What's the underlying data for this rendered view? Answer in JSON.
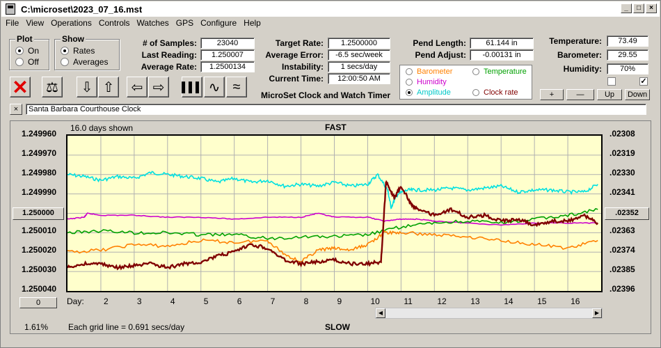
{
  "window": {
    "title": "C:\\microset\\2023_07_16.mst"
  },
  "menu": [
    "File",
    "View",
    "Operations",
    "Controls",
    "Watches",
    "GPS",
    "Configure",
    "Help"
  ],
  "plot_group": {
    "title": "Plot",
    "options": [
      {
        "label": "On",
        "selected": true
      },
      {
        "label": "Off",
        "selected": false
      }
    ]
  },
  "show_group": {
    "title": "Show",
    "options": [
      {
        "label": "Rates",
        "selected": true
      },
      {
        "label": "Averages",
        "selected": false
      }
    ]
  },
  "stats": {
    "samples_label": "# of Samples:",
    "samples": "23040",
    "last_label": "Last Reading:",
    "last": "1.250007",
    "avg_label": "Average Rate:",
    "avg": "1.2500134"
  },
  "target": {
    "rate_label": "Target Rate:",
    "rate": "1.2500000",
    "err_label": "Average Error:",
    "err": "-6.5 sec/week",
    "inst_label": "Instability:",
    "inst": "1 secs/day",
    "time_label": "Current Time:",
    "time": "12:00:50 AM"
  },
  "program_title": "MicroSet Clock and Watch Timer",
  "pend": {
    "len_label": "Pend Length:",
    "len": "61.144 in",
    "adj_label": "Pend Adjust:",
    "adj": "-0.00131 in"
  },
  "env": {
    "temp_label": "Temperature:",
    "temp": "73.49",
    "baro_label": "Barometer:",
    "baro": "29.55",
    "hum_label": "Humidity:",
    "hum": "70%"
  },
  "legend": [
    {
      "label": "Barometer",
      "color": "#ff8000",
      "selected": false
    },
    {
      "label": "Temperature",
      "color": "#00a000",
      "selected": false
    },
    {
      "label": "Humidity",
      "color": "#cc00cc",
      "selected": false
    },
    {
      "label": "Amplitude",
      "color": "#00c8c8",
      "selected": true
    },
    {
      "label": "Clock rate",
      "color": "#800000",
      "selected": false
    }
  ],
  "adjust_buttons": [
    "+",
    "—",
    "Up",
    "Down"
  ],
  "clock_name": "Santa Barbara Courthouse Clock",
  "close_x": "×",
  "chart_header": {
    "days_shown": "16.0 days shown",
    "fast": "FAST",
    "slow": "SLOW",
    "grid_note": "Each grid line = 0.691 secs/day",
    "percent": "1.61%",
    "day_label": "Day:"
  },
  "left_buttons": {
    "center": "1.250000",
    "bottom": "0"
  },
  "right_button": ".02352",
  "chart_data": {
    "type": "line",
    "y_left_ticks": [
      "1.249960",
      "1.249970",
      "1.249980",
      "1.249990",
      "1.250000",
      "1.250010",
      "1.250020",
      "1.250030",
      "1.250040"
    ],
    "y_right_ticks": [
      ".02308",
      ".02319",
      ".02330",
      ".02341",
      ".02352",
      ".02363",
      ".02374",
      ".02385",
      ".02396"
    ],
    "x_ticks": [
      "2",
      "3",
      "4",
      "5",
      "6",
      "7",
      "8",
      "9",
      "10",
      "11",
      "12",
      "13",
      "14",
      "15",
      "16"
    ],
    "xlim": [
      1,
      17
    ],
    "ylim": [
      1.24996,
      1.25004
    ],
    "series": [
      {
        "color": "#00e0e0",
        "x": [
          1,
          1.5,
          2,
          2.5,
          3,
          3.5,
          4,
          4.5,
          5,
          5.5,
          6,
          6.5,
          7,
          7.5,
          8,
          8.5,
          9,
          9.5,
          10,
          10.3,
          10.6,
          10.7,
          10.9,
          11.2,
          11.5,
          12,
          12.5,
          13,
          13.5,
          14,
          14.5,
          15,
          15.5,
          16,
          16.5,
          16.9
        ],
        "y": [
          1.24998,
          1.249981,
          1.249983,
          1.249981,
          1.249982,
          1.249979,
          1.24998,
          1.249981,
          1.249982,
          1.249984,
          1.249982,
          1.249984,
          1.249983,
          1.249986,
          1.249985,
          1.249986,
          1.249984,
          1.249986,
          1.249985,
          1.24998,
          1.249988,
          1.249997,
          1.24999,
          1.249988,
          1.249988,
          1.249988,
          1.249987,
          1.249988,
          1.249987,
          1.249986,
          1.249989,
          1.249988,
          1.249988,
          1.249989,
          1.249989,
          1.249985
        ]
      },
      {
        "color": "#cc00cc",
        "x": [
          1,
          1.5,
          1.6,
          2,
          3,
          4,
          5,
          6,
          7,
          8,
          8.5,
          9,
          10,
          10.5,
          11,
          11.5,
          12,
          13,
          14,
          15,
          16,
          16.9
        ],
        "y": [
          1.250003,
          1.250002,
          1.25,
          1.250001,
          1.250001,
          1.250002,
          1.250002,
          1.250003,
          1.250002,
          1.250002,
          1.25,
          1.250002,
          1.250002,
          1.250004,
          1.250003,
          1.250003,
          1.250004,
          1.250005,
          1.250006,
          1.250005,
          1.250005,
          1.250005
        ]
      },
      {
        "color": "#00a000",
        "x": [
          1,
          2,
          3,
          4,
          5,
          6,
          7,
          8,
          9,
          10,
          11,
          12,
          13,
          14,
          15,
          16,
          16.9
        ],
        "y": [
          1.25001,
          1.250009,
          1.25001,
          1.25001,
          1.250011,
          1.250011,
          1.250013,
          1.250012,
          1.250012,
          1.250011,
          1.250007,
          1.250005,
          1.250004,
          1.250005,
          1.250003,
          1.250001,
          1.249998
        ]
      },
      {
        "color": "#ff8000",
        "x": [
          1,
          2,
          3,
          4,
          5,
          6,
          7,
          7.5,
          8,
          8.5,
          9,
          9.5,
          10,
          10.5,
          11,
          12,
          13,
          14,
          15,
          16,
          16.9
        ],
        "y": [
          1.25002,
          1.250019,
          1.250016,
          1.250017,
          1.250014,
          1.250015,
          1.250014,
          1.250021,
          1.250025,
          1.250019,
          1.250018,
          1.250019,
          1.250016,
          1.25001,
          1.25001,
          1.250011,
          1.250012,
          1.250014,
          1.250016,
          1.250018,
          1.250014
        ]
      },
      {
        "color": "#800000",
        "x": [
          1,
          1.5,
          2,
          2.5,
          3,
          3.5,
          4,
          4.5,
          5,
          5.5,
          6,
          6.5,
          7,
          7.5,
          8,
          8.5,
          9,
          9.5,
          10,
          10.4,
          10.55,
          10.6,
          10.8,
          11,
          11.3,
          11.5,
          12,
          12.5,
          13,
          13.5,
          14,
          14.5,
          15,
          15.5,
          16,
          16.5,
          16.9
        ],
        "y": [
          1.250028,
          1.250026,
          1.250026,
          1.250028,
          1.250027,
          1.250026,
          1.250028,
          1.250026,
          1.250025,
          1.250022,
          1.25002,
          1.250016,
          1.250018,
          1.250024,
          1.250026,
          1.250025,
          1.250024,
          1.250026,
          1.250026,
          1.250025,
          1.249984,
          1.249985,
          1.249992,
          1.249986,
          1.249995,
          1.249998,
          1.250001,
          1.249998,
          1.250002,
          1.250001,
          1.250004,
          1.250003,
          1.250006,
          1.250004,
          1.250004,
          1.250001,
          1.250005
        ]
      }
    ]
  }
}
